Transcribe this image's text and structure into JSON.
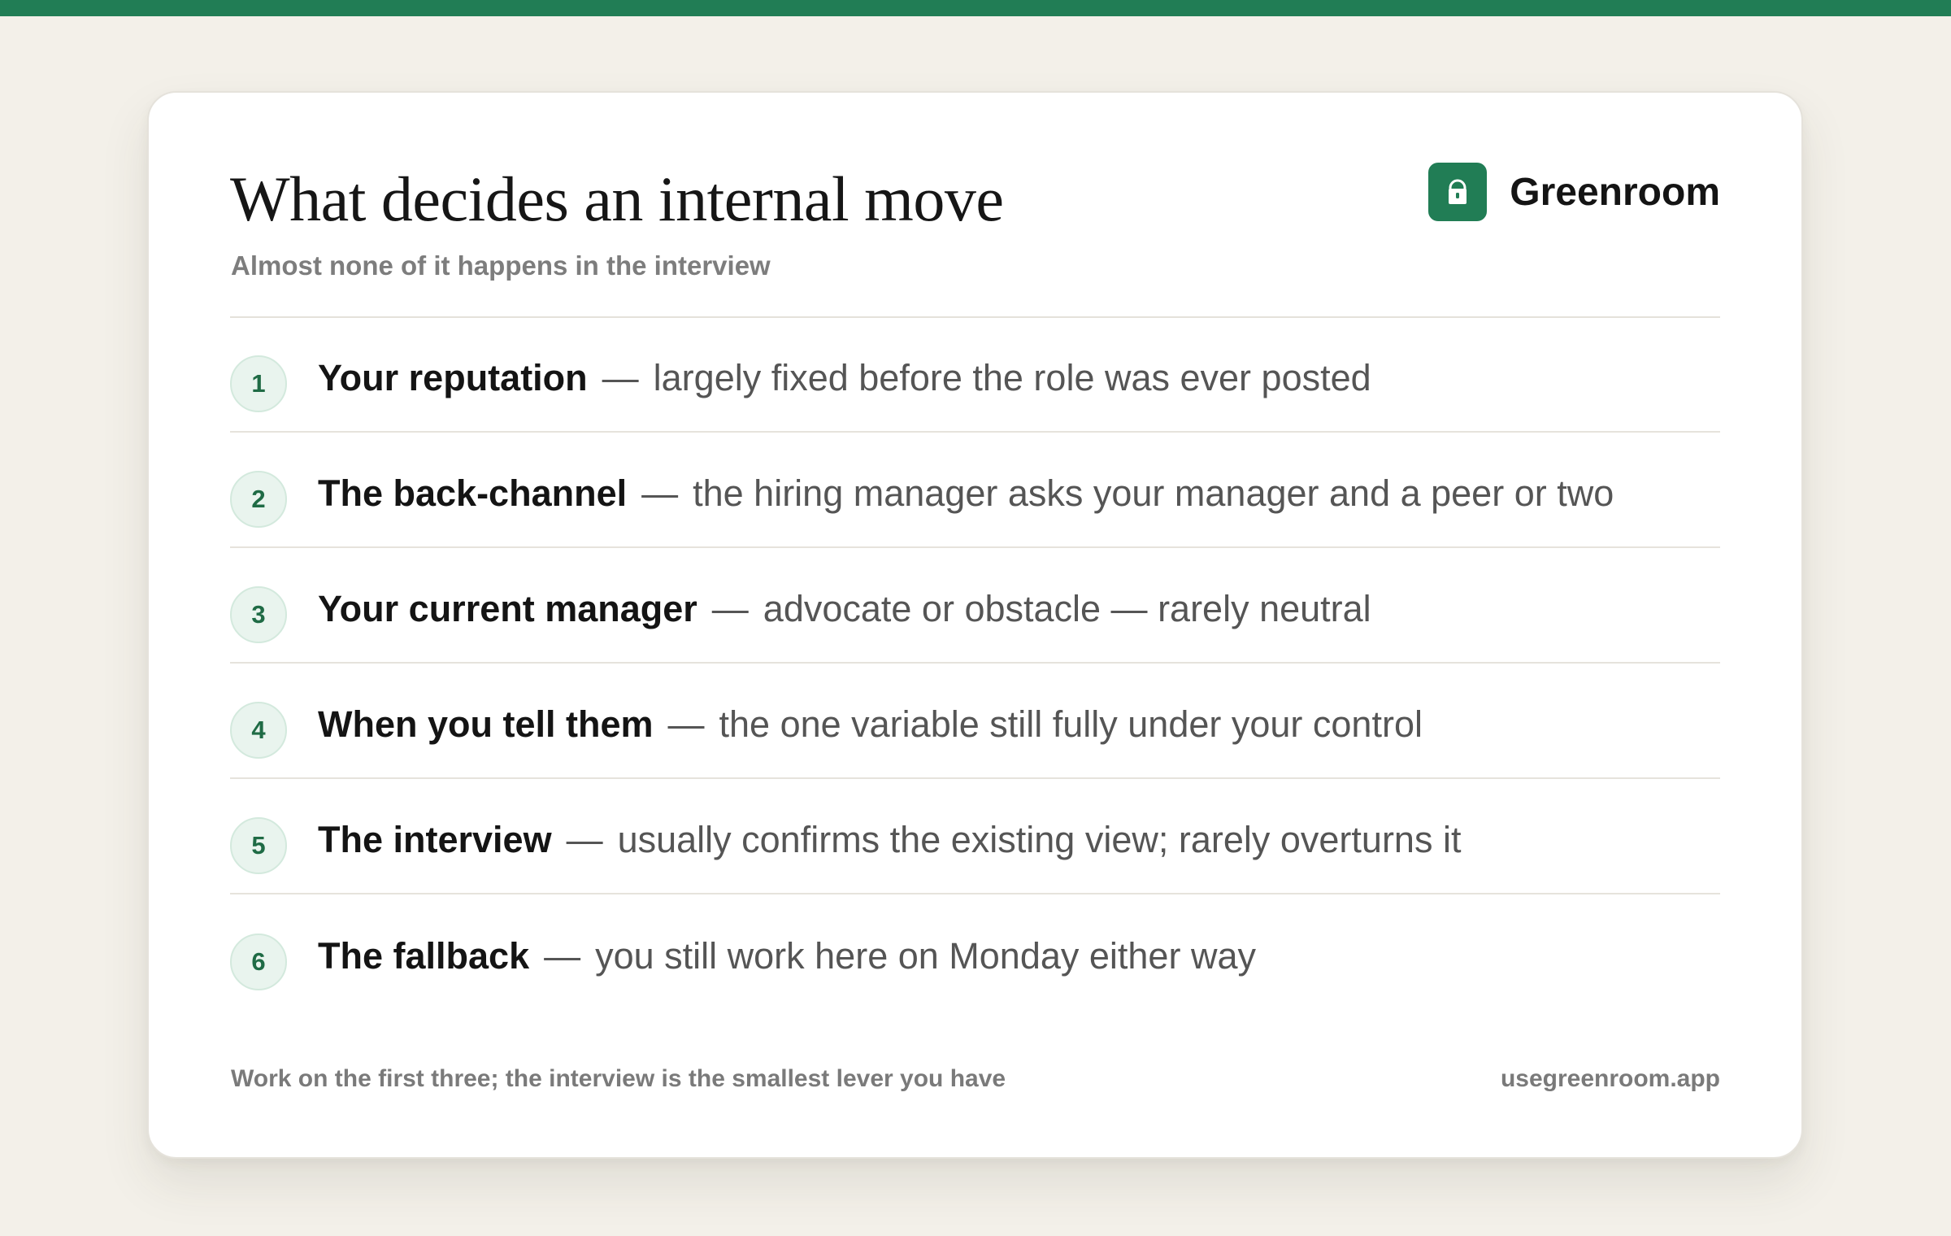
{
  "colors": {
    "accent": "#217d55",
    "background": "#f3f0e9",
    "card": "#ffffff",
    "badge_bg": "#e9f4ee",
    "badge_text": "#1f6b45"
  },
  "header": {
    "title": "What decides an internal move",
    "subtitle": "Almost none of it happens in the interview"
  },
  "brand": {
    "name": "Greenroom",
    "icon": "lock-icon"
  },
  "items": [
    {
      "number": "1",
      "label": "Your reputation",
      "separator": "—",
      "description": "largely fixed before the role was ever posted"
    },
    {
      "number": "2",
      "label": "The back-channel",
      "separator": "—",
      "description": "the hiring manager asks your manager and a peer or two"
    },
    {
      "number": "3",
      "label": "Your current manager",
      "separator": "—",
      "description": "advocate or obstacle — rarely neutral"
    },
    {
      "number": "4",
      "label": "When you tell them",
      "separator": "—",
      "description": "the one variable still fully under your control"
    },
    {
      "number": "5",
      "label": "The interview",
      "separator": "—",
      "description": "usually confirms the existing view; rarely overturns it"
    },
    {
      "number": "6",
      "label": "The fallback",
      "separator": "—",
      "description": "you still work here on Monday either way"
    }
  ],
  "footer": {
    "note": "Work on the first three; the interview is the smallest lever you have",
    "url": "usegreenroom.app"
  }
}
